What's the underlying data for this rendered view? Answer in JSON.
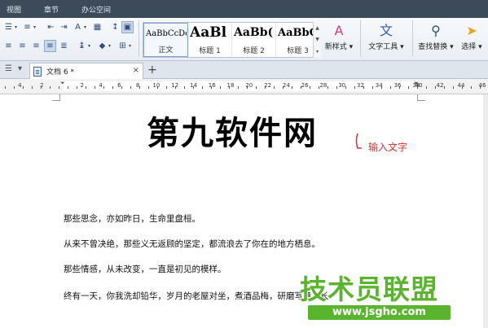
{
  "menu": {
    "tabs": [
      "视图",
      "章节",
      "办公空间"
    ]
  },
  "styles": [
    {
      "preview": "AaBbCcDd",
      "name": "正文"
    },
    {
      "preview": "AaBl",
      "name": "标题 1"
    },
    {
      "preview": "AaBb(",
      "name": "标题 2"
    },
    {
      "preview": "AaBbC",
      "name": "标题 3"
    }
  ],
  "ribbon": {
    "new_style_label": "新样式 ▾",
    "text_tools_label": "文字工具 ▾",
    "find_replace_label": "查找替换 ▾",
    "select_label": "选择 ▾"
  },
  "tab": {
    "title": "文档 6 *",
    "close": "×",
    "new": "+"
  },
  "ruler": {
    "left_numbers": [
      "6",
      "4",
      "2"
    ],
    "numbers": [
      "2",
      "4",
      "6",
      "8",
      "10",
      "12",
      "14",
      "16",
      "18",
      "20",
      "22",
      "24",
      "26",
      "28",
      "30",
      "32",
      "34",
      "36",
      "38"
    ],
    "right_numbers": [
      "40",
      "42",
      "44",
      "46"
    ]
  },
  "document": {
    "heading": "第九软件网",
    "annotation": "输入文字",
    "paragraphs": [
      "那些思念，亦如昨日，生命里盘桓。",
      "从来不曾决绝，那些义无返顾的坚定，都流浪去了你在的地方栖息。",
      "那些情感，从未改变，一直是初见的模样。",
      "终有一天，你我洗却铅华，岁月的老屋对坐，煮酒品梅，研磨写意，长"
    ]
  },
  "watermark": {
    "title": "技术员联盟",
    "url": "www.jsgho.com"
  },
  "colors": {
    "menubar": "#3d4a59",
    "annotation": "#d8302a",
    "watermark": "#5ab42e"
  }
}
